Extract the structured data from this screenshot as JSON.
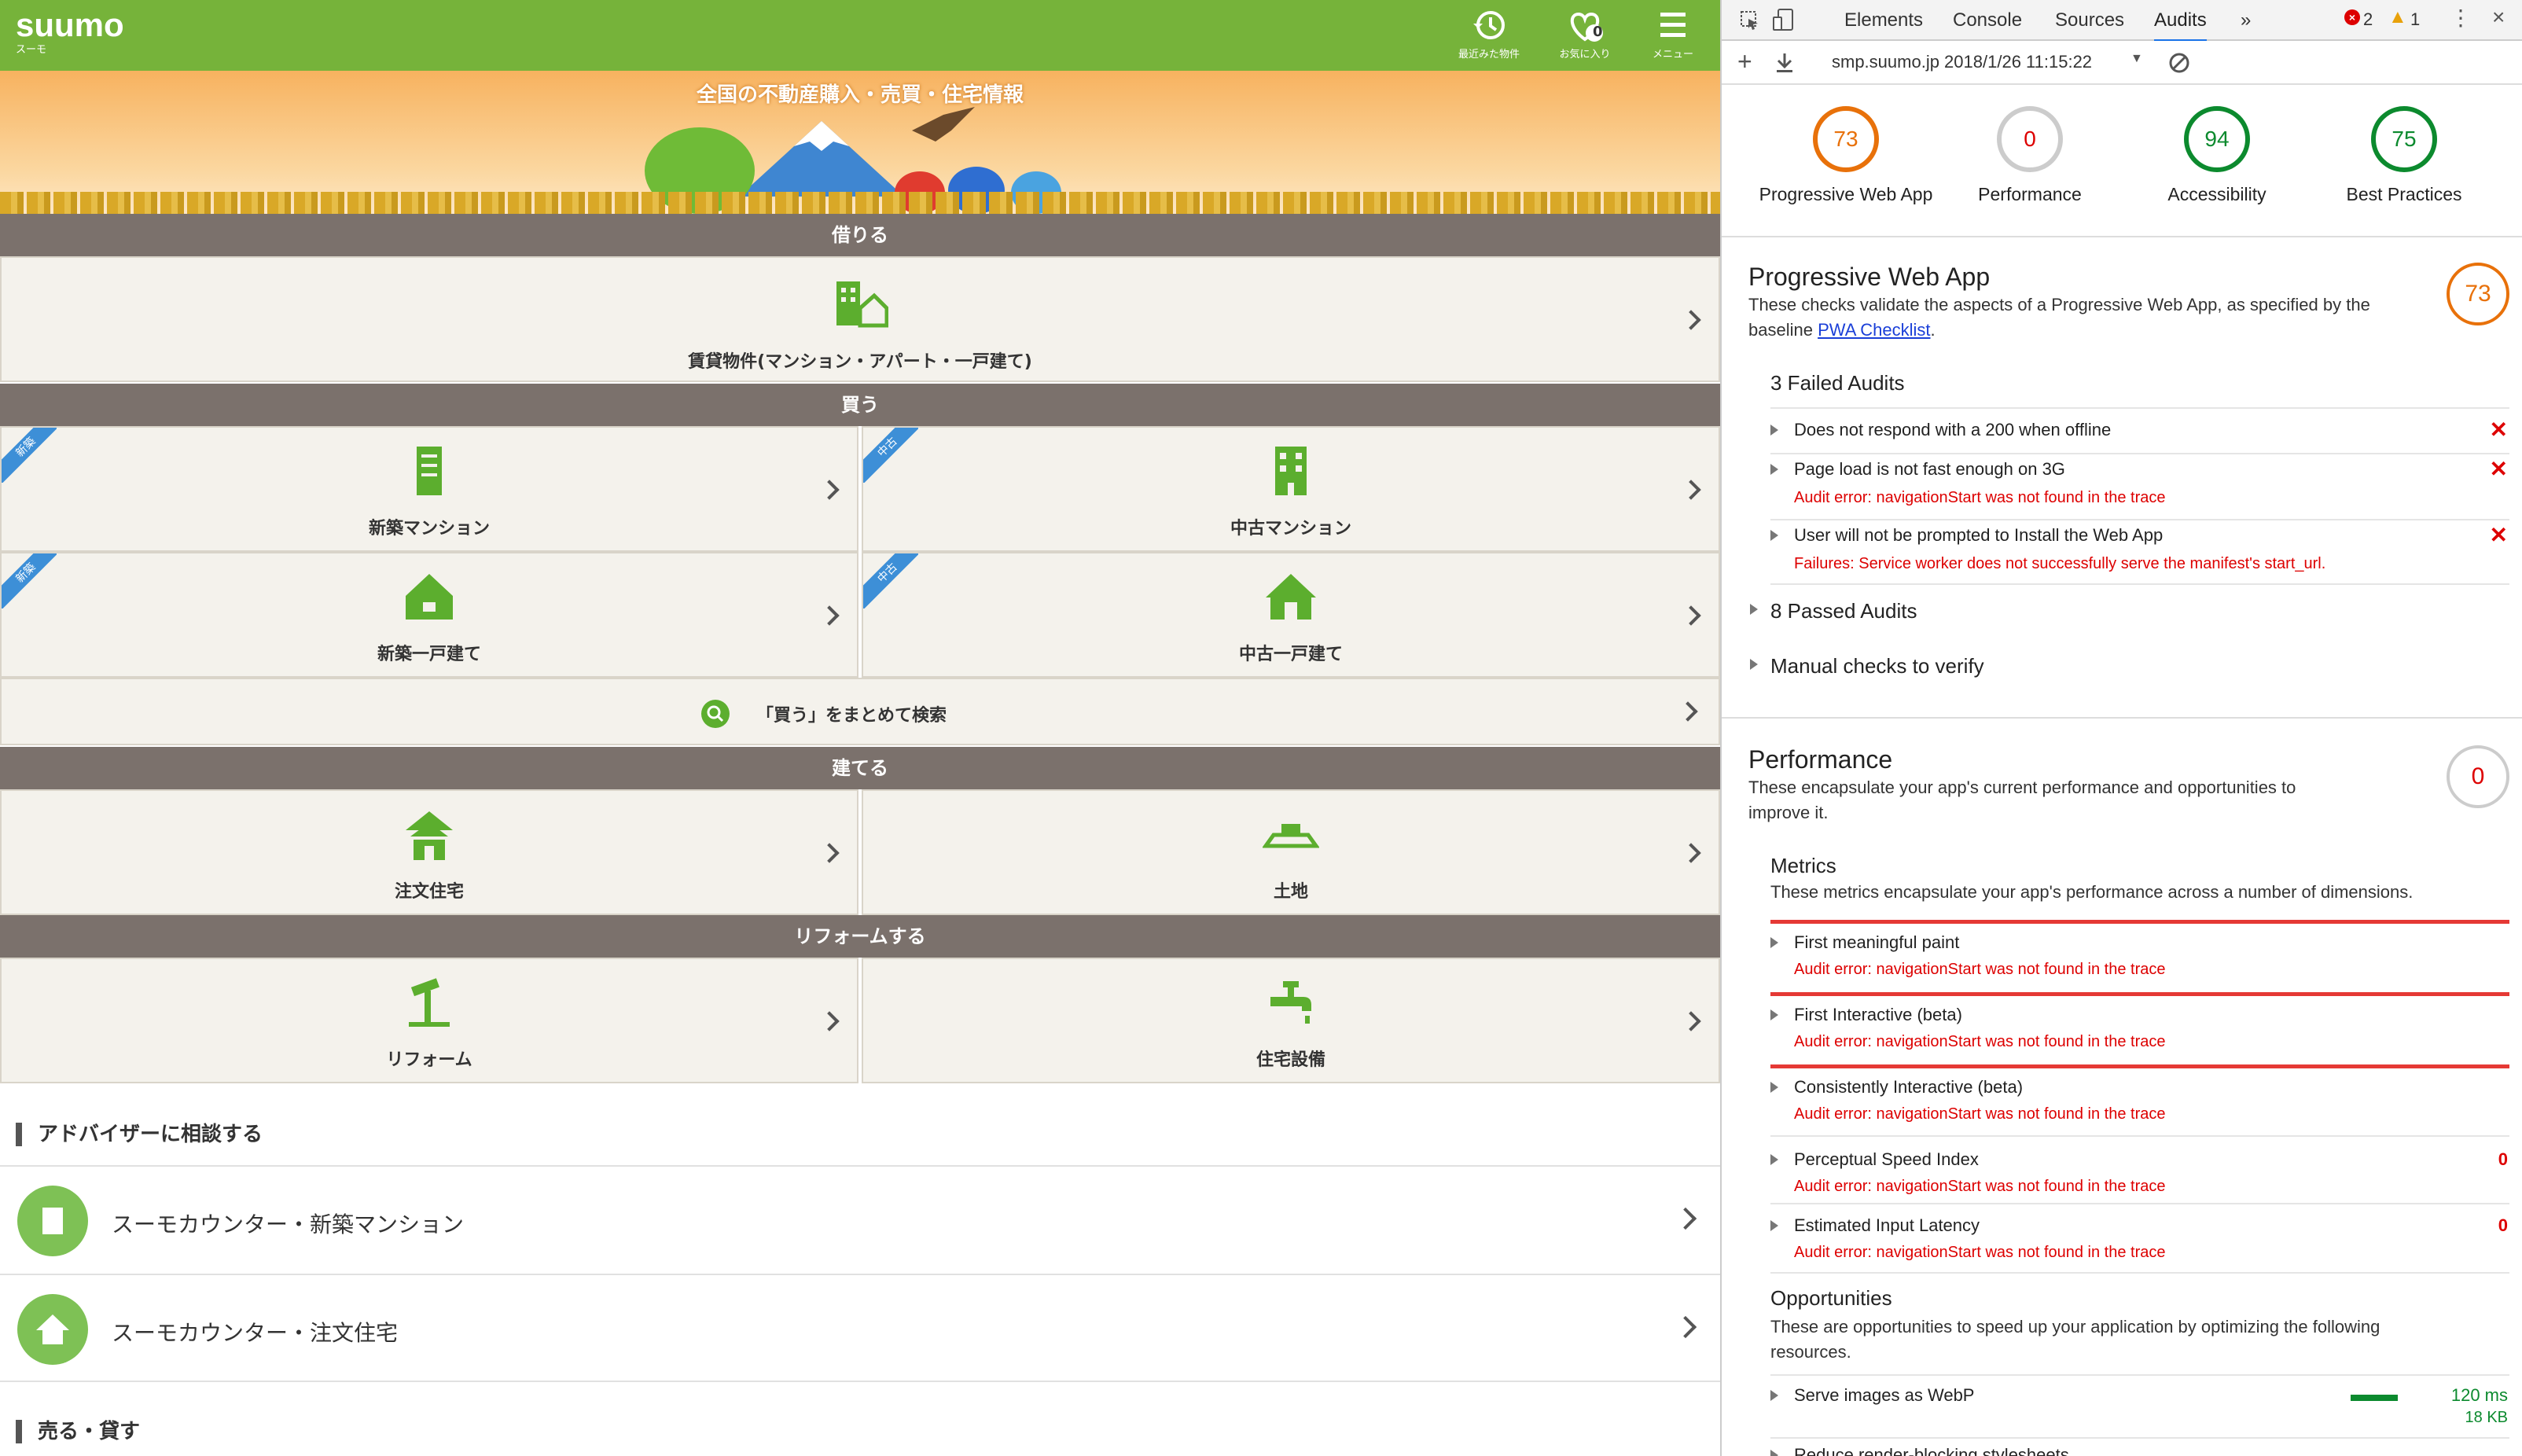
{
  "site": {
    "logo": "suumo",
    "logo_sub": "スーモ",
    "header_buttons": [
      {
        "label": "最近みた物件",
        "icon": "history-icon"
      },
      {
        "label": "お気に入り",
        "icon": "heart-icon",
        "badge": "0"
      },
      {
        "label": "メニュー",
        "icon": "menu-icon"
      }
    ],
    "banner_title": "全国の不動産購入・売買・住宅情報",
    "sections": {
      "rent": {
        "title": "借りる",
        "tile": "賃貸物件(マンション・アパート・一戸建て)"
      },
      "buy": {
        "title": "買う",
        "tiles": [
          {
            "label": "新築マンション",
            "ribbon": "新築"
          },
          {
            "label": "中古マンション",
            "ribbon": "中古"
          },
          {
            "label": "新築一戸建て",
            "ribbon": "新築"
          },
          {
            "label": "中古一戸建て",
            "ribbon": "中古"
          }
        ],
        "search": "「買う」をまとめて検索"
      },
      "build": {
        "title": "建てる",
        "tiles": [
          {
            "label": "注文住宅"
          },
          {
            "label": "土地"
          }
        ]
      },
      "reform": {
        "title": "リフォームする",
        "tiles": [
          {
            "label": "リフォーム"
          },
          {
            "label": "住宅設備"
          }
        ]
      }
    },
    "advisor": {
      "title": "アドバイザーに相談する",
      "rows": [
        "スーモカウンター・新築マンション",
        "スーモカウンター・注文住宅"
      ]
    },
    "sell_title": "売る・貸す"
  },
  "devtools": {
    "tabs": [
      "Elements",
      "Console",
      "Sources",
      "Audits"
    ],
    "more": "»",
    "errors": "2",
    "warnings": "1",
    "report_url": "smp.suumo.jp 2018/1/26 11:15:22",
    "scores": [
      {
        "label": "Progressive Web App",
        "value": "73",
        "color": "#e8710a"
      },
      {
        "label": "Performance",
        "value": "0",
        "color": "#d00"
      },
      {
        "label": "Accessibility",
        "value": "94",
        "color": "#0c8a2e"
      },
      {
        "label": "Best Practices",
        "value": "75",
        "color": "#0c8a2e"
      }
    ],
    "pwa": {
      "title": "Progressive Web App",
      "desc_prefix": "These checks validate the aspects of a Progressive Web App, as specified by the baseline",
      "link": "PWA Checklist",
      "score": "73",
      "failed_title": "3 Failed Audits",
      "failed": [
        {
          "title": "Does not respond with a 200 when offline",
          "error": ""
        },
        {
          "title": "Page load is not fast enough on 3G",
          "error": "Audit error: navigationStart was not found in the trace"
        },
        {
          "title": "User will not be prompted to Install the Web App",
          "error": "Failures: Service worker does not successfully serve the manifest's start_url."
        }
      ],
      "passed": "8 Passed Audits",
      "manual": "Manual checks to verify"
    },
    "perf": {
      "title": "Performance",
      "desc": "These encapsulate your app's current performance and opportunities to improve it.",
      "score": "0",
      "metrics_title": "Metrics",
      "metrics_desc": "These metrics encapsulate your app's performance across a number of dimensions.",
      "metrics": [
        {
          "title": "First meaningful paint",
          "error": "Audit error: navigationStart was not found in the trace",
          "value": ""
        },
        {
          "title": "First Interactive (beta)",
          "error": "Audit error: navigationStart was not found in the trace",
          "value": ""
        },
        {
          "title": "Consistently Interactive (beta)",
          "error": "Audit error: navigationStart was not found in the trace",
          "value": ""
        },
        {
          "title": "Perceptual Speed Index",
          "error": "Audit error: navigationStart was not found in the trace",
          "value": "0"
        },
        {
          "title": "Estimated Input Latency",
          "error": "Audit error: navigationStart was not found in the trace",
          "value": "0"
        }
      ],
      "opp_title": "Opportunities",
      "opp_desc": "These are opportunities to speed up your application by optimizing the following resources.",
      "opps": [
        {
          "title": "Serve images as WebP",
          "time": "120 ms",
          "size": "18 KB"
        }
      ],
      "opp_cut": "Reduce render-blocking stylesheets"
    }
  }
}
